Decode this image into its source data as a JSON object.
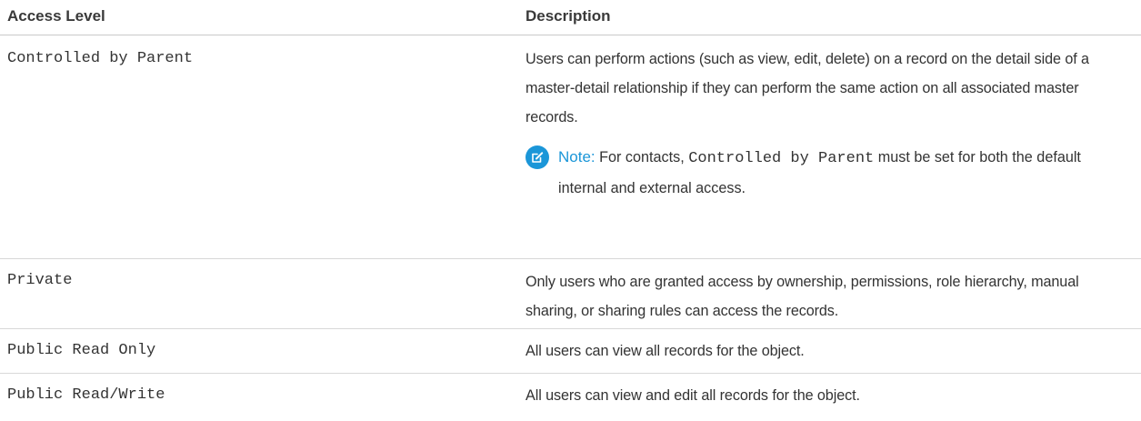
{
  "table": {
    "headers": {
      "access_level": "Access Level",
      "description": "Description"
    },
    "rows": [
      {
        "level": "Controlled by Parent",
        "description": "Users can perform actions (such as view, edit, delete) on a record on the detail side of a master-detail relationship if they can perform the same action on all associated master records.",
        "note": {
          "label": "Note:",
          "prefix": "For contacts,",
          "code": "Controlled by Parent",
          "suffix": "must be set for both the default internal and external access."
        }
      },
      {
        "level": "Private",
        "description": "Only users who are granted access by ownership, permissions, role hierarchy, manual sharing, or sharing rules can access the records."
      },
      {
        "level": "Public Read Only",
        "description": "All users can view all records for the object."
      },
      {
        "level": "Public Read/Write",
        "description": "All users can view and edit all records for the object."
      }
    ]
  },
  "icons": {
    "note_icon": "edit-note-icon"
  },
  "colors": {
    "accent": "#1b96d8",
    "text": "#333333",
    "divider": "#d8d8d8"
  }
}
